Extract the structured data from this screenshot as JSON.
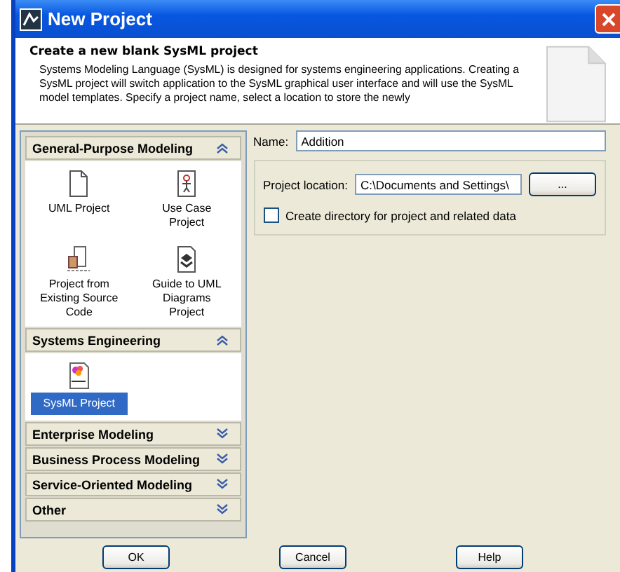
{
  "window": {
    "title": "New Project"
  },
  "header": {
    "title": "Create a new blank SysML project",
    "description": "Systems Modeling Language (SysML) is designed for systems engineering applications. Creating a SysML project will switch application to the SysML graphical user interface and will use the SysML model templates. Specify a project name, select a location to store the newly"
  },
  "categories": [
    {
      "label": "General-Purpose Modeling",
      "expanded": true,
      "items": [
        {
          "label": "UML Project",
          "kind": "page",
          "selected": false
        },
        {
          "label": "Use Case Project",
          "kind": "usecase",
          "selected": false
        },
        {
          "label": "Project from Existing Source Code",
          "kind": "source",
          "selected": false
        },
        {
          "label": "Guide to UML Diagrams Project",
          "kind": "guide",
          "selected": false
        }
      ]
    },
    {
      "label": "Systems Engineering",
      "expanded": true,
      "items": [
        {
          "label": "SysML Project",
          "kind": "sysml",
          "selected": true
        }
      ]
    },
    {
      "label": "Enterprise Modeling",
      "expanded": false
    },
    {
      "label": "Business Process Modeling",
      "expanded": false
    },
    {
      "label": "Service-Oriented Modeling",
      "expanded": false
    },
    {
      "label": "Other",
      "expanded": false
    }
  ],
  "name_field": {
    "label": "Name:",
    "value": "Addition"
  },
  "location_field": {
    "label": "Project location:",
    "value": "C:\\Documents and Settings\\",
    "browse": "..."
  },
  "create_directory": {
    "label": "Create directory for project and related data",
    "checked": false
  },
  "buttons": [
    "OK",
    "Cancel",
    "Help"
  ]
}
